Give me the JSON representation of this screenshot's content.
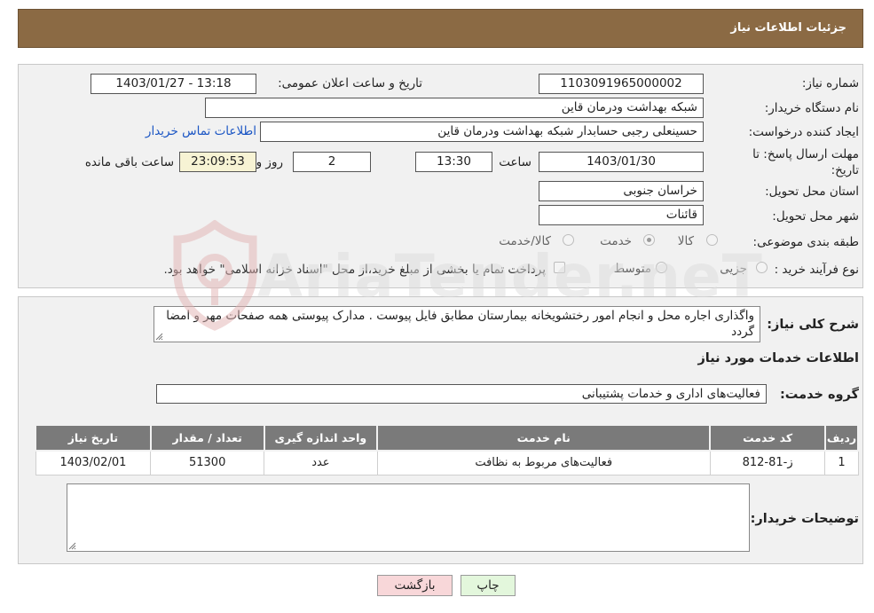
{
  "header": {
    "title": "جزئیات اطلاعات نیاز"
  },
  "form": {
    "need_number_label": "شماره نیاز:",
    "need_number": "1103091965000002",
    "announce_label": "تاریخ و ساعت اعلان عمومی:",
    "announce_value": "1403/01/27 - 13:18",
    "buyer_org_label": "نام دستگاه خریدار:",
    "buyer_org": "شبکه بهداشت ودرمان قاین",
    "creator_label": "ایجاد کننده درخواست:",
    "creator": "حسینعلی رجبی حسابدار شبکه بهداشت ودرمان قاین",
    "contact_link": "اطلاعات تماس خریدار",
    "deadline_label_1": "مهلت ارسال پاسخ: تا",
    "deadline_label_2": "تاریخ:",
    "deadline_date": "1403/01/30",
    "time_label": "ساعت",
    "deadline_time": "13:30",
    "days_value": "2",
    "days_label": "روز و",
    "remaining_time": "23:09:53",
    "remaining_label": "ساعت باقی مانده",
    "province_label": "استان محل تحویل:",
    "province": "خراسان جنوبی",
    "city_label": "شهر محل تحویل:",
    "city": "قائنات",
    "category_label": "طبقه بندی موضوعی:",
    "category_options": [
      "کالا",
      "خدمت",
      "کالا/خدمت"
    ],
    "category_selected": "خدمت",
    "process_label": "نوع فرآیند خرید :",
    "process_options": [
      "جزیی",
      "متوسط"
    ],
    "process_note": "پرداخت تمام یا بخشی از مبلغ خرید،از محل \"اسناد خزانه اسلامی\" خواهد بود."
  },
  "details": {
    "summary_label": "شرح کلی نیاز:",
    "summary": "واگذاری اجاره محل و انجام امور رختشویخانه بیمارستان مطابق فایل پیوست . مدارک پیوستی همه صفحات مهر و امضا گردد",
    "services_title": "اطلاعات خدمات مورد نیاز",
    "service_group_label": "گروه خدمت:",
    "service_group": "فعالیت‌های اداری و خدمات پشتیبانی",
    "buyer_notes_label": "توضیحات خریدار:",
    "buyer_notes": ""
  },
  "table": {
    "headers": [
      "ردیف",
      "کد خدمت",
      "نام خدمت",
      "واحد اندازه گیری",
      "تعداد / مقدار",
      "تاریخ نیاز"
    ],
    "rows": [
      [
        "1",
        "ز-81-812",
        "فعالیت‌های مربوط به نظافت",
        "عدد",
        "51300",
        "1403/02/01"
      ]
    ]
  },
  "buttons": {
    "print": "چاپ",
    "back": "بازگشت"
  },
  "watermark": {
    "text": "AriaTender.neT"
  },
  "colors": {
    "header": "#8b6a44",
    "table_header": "#7a7a7a",
    "link": "#1a55c4"
  }
}
